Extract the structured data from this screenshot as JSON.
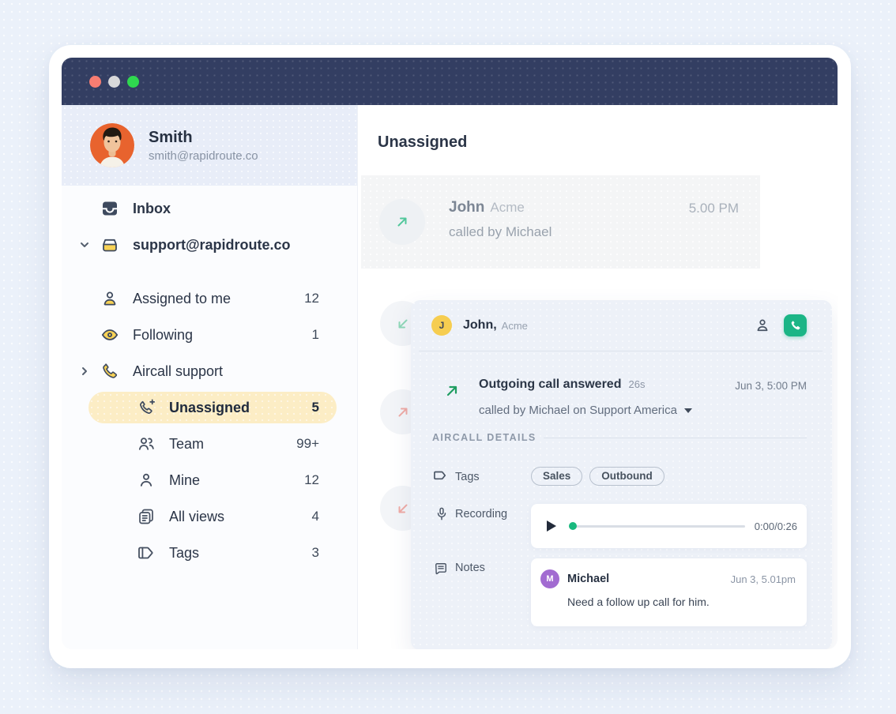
{
  "window": {
    "traffic_lights": [
      "red",
      "gray",
      "green"
    ]
  },
  "sidebar": {
    "profile": {
      "name": "Smith",
      "email": "smith@rapidroute.co"
    },
    "items": [
      {
        "label": "Inbox",
        "icon": "inbox-icon"
      },
      {
        "label": "support@rapidroute.co",
        "icon": "mailbox-icon",
        "state": "expanded"
      },
      {
        "label": "Assigned to me",
        "count": "12",
        "icon": "person-icon"
      },
      {
        "label": "Following",
        "count": "1",
        "icon": "eye-icon"
      },
      {
        "label": "Aircall support",
        "icon": "phone-icon",
        "state": "collapsed"
      },
      {
        "label": "Unassigned",
        "count": "5",
        "icon": "phone-add-icon",
        "state": "active"
      },
      {
        "label": "Team",
        "count": "99+",
        "icon": "team-icon"
      },
      {
        "label": "Mine",
        "count": "12",
        "icon": "person-outline-icon"
      },
      {
        "label": "All views",
        "count": "4",
        "icon": "copies-icon"
      },
      {
        "label": "Tags",
        "count": "3",
        "icon": "tag-icon"
      }
    ]
  },
  "main": {
    "title": "Unassigned",
    "list_item": {
      "name": "John",
      "company": "Acme",
      "time": "5.00 PM",
      "subtitle": "called by Michael",
      "direction": "outgoing"
    },
    "detail": {
      "contact_initial": "J",
      "contact_name": "John,",
      "contact_company": "Acme",
      "event_title": "Outgoing call answered",
      "event_duration": "26s",
      "event_time": "Jun 3, 5:00 PM",
      "event_subtitle": "called by Michael on Support America",
      "section_title": "AIRCALL DETAILS",
      "tags_label": "Tags",
      "tags": [
        "Sales",
        "Outbound"
      ],
      "recording_label": "Recording",
      "recording_time": "0:00/0:26",
      "notes_label": "Notes",
      "note": {
        "initial": "M",
        "author": "Michael",
        "time": "Jun 3, 5.01pm",
        "body": "Need a follow up call for him."
      }
    }
  },
  "colors": {
    "titlebar_navy": "#333e62",
    "accent_green": "#1bb586",
    "highlight_yellow": "#fcedc5",
    "icon_yellow": "#f8d255",
    "note_purple": "#a26bd1",
    "missed_pink": "#efaaa5",
    "answered_mint": "#52c79b"
  }
}
